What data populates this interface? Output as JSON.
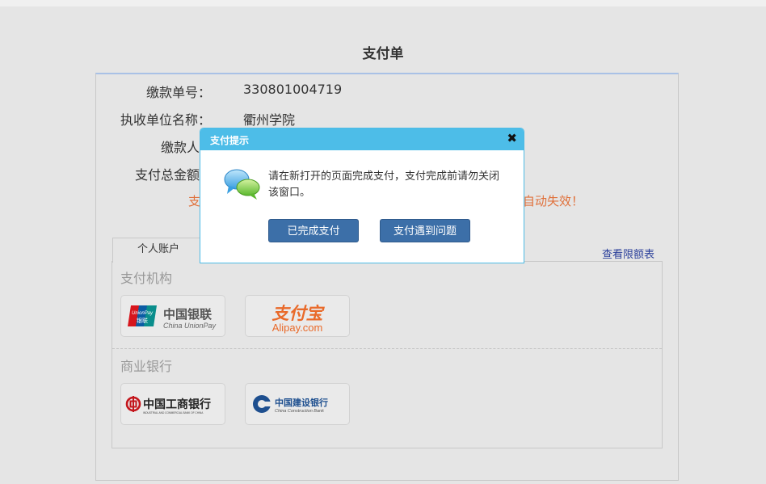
{
  "page": {
    "title": "支付单"
  },
  "info": {
    "order_no_label": "缴款单号：",
    "order_no_value": "330801004719",
    "payee_label": "执收单位名称：",
    "payee_value": "衢州学院",
    "payer_label": "缴款人",
    "total_label": "支付总金额",
    "warning_left": "支",
    "warning_right": "自动失效！"
  },
  "account": {
    "tab_label": "个人账户",
    "limit_link": "查看限额表",
    "section_payment": "支付机构",
    "section_bank": "商业银行",
    "banks": {
      "unionpay": {
        "cn": "中国银联",
        "en": "China UnionPay",
        "badge_top": "UnionPay",
        "badge_bottom": "银联"
      },
      "alipay": {
        "cn": "支付宝",
        "en": "Alipay.com"
      },
      "icbc": {
        "cn": "中国工商银行",
        "en": "INDUSTRIAL AND COMMERCIAL BANK OF CHINA"
      },
      "ccb": {
        "cn": "中国建设银行",
        "en": "China Construction Bank"
      }
    }
  },
  "dialog": {
    "title": "支付提示",
    "close": "✖",
    "message": "请在新打开的页面完成支付，支付完成前请勿关闭该窗口。",
    "btn_done": "已完成支付",
    "btn_problem": "支付遇到问题"
  },
  "colors": {
    "dialog_header": "#4dbde8",
    "button": "#3c6fa8",
    "warning": "#e0703a",
    "link": "#2a3f9a"
  }
}
